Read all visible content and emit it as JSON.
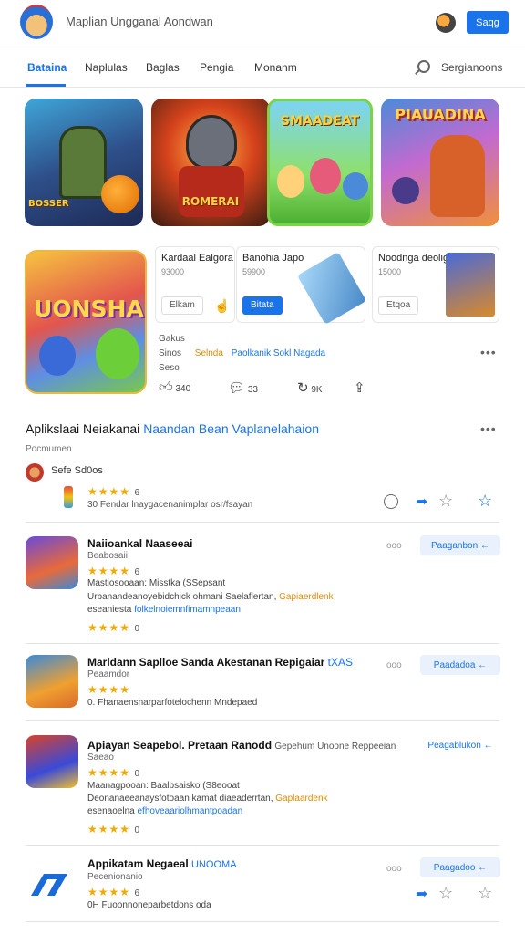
{
  "header": {
    "app_title": "Maplian Ungganal Aondwan",
    "login_label": "Saqg",
    "icons": [
      "avatar",
      "bell-icon"
    ]
  },
  "tabs": {
    "items": [
      "Bataina",
      "Naplulas",
      "Baglas",
      "Pengia",
      "Monanm"
    ],
    "active": "Bataina",
    "search_label": "Sergianoons"
  },
  "banners": [
    {
      "text": "BOSSER"
    },
    {
      "text": "ROMERAI"
    },
    {
      "text": "SMAADEAT"
    },
    {
      "text": "PIAUADINA"
    }
  ],
  "featured": {
    "icon_word": "UONSHAN",
    "cards": [
      {
        "title": "Kardaal Ealgora",
        "sub": "93000",
        "button": "Elkam"
      },
      {
        "title": "Banohia Japo",
        "sub": "59900",
        "button": "Bitata"
      },
      {
        "title": "Noodnga deolig",
        "sub": "15000",
        "button": "Etqoa"
      }
    ],
    "meta1": "Gakus",
    "meta2_label": "Sinos",
    "meta2_highlight": "Selnda",
    "meta2_links": "Paolkanik  Sokl  Nagada",
    "meta3": "Seso",
    "actions": {
      "likes": "340",
      "comments": "33",
      "shares": "9K"
    }
  },
  "section": {
    "title_dark": "Aplikslaai Neiakanai ",
    "title_blue": "Naandan Bean Vaplanelahaion",
    "subtitle": "Pocmumen",
    "author": "Sefe  Sd0os",
    "rating": "6",
    "review": "30 Fendar lnaygacenanimplar osr/fsayan"
  },
  "items": [
    {
      "title": "Naiioankal Naaseeai",
      "sub": "Beabosaii",
      "rating1": "6",
      "line1": "Mastiosooaan: Misstka (SSepsant",
      "line2_main": "Urbanandeanoyebidchick ohmani Saelaflertan, ",
      "line2_hl": "Gapiaerdlenk",
      "line3_main": "eseaniesta ",
      "line3_blue": "folkelnoiemnfimamnpeaan",
      "rating2": "0",
      "pill": "Paaganbon ←",
      "tag": "ooo"
    },
    {
      "title": "Marldann Saplloe Sanda Akestanan Repigaiar ",
      "title_blue": "tXAS",
      "sub": "Peaamdor",
      "line1": "0. Fhanaensnarparfotelochenn Mndepaed",
      "pill": "Paadadoa ←",
      "tag": "ooo"
    },
    {
      "title": "Apiayan Seapebol. Pretaan Ranodd ",
      "title_blue": "Gepehum Unoone Reppeeian",
      "sub": "Saeao",
      "rating1": "0",
      "line1": "Maanagpooan: Baalbsaisko (S8eooat",
      "line2_main": "Deonanaeeanaysfotoaan kamat diaeaderrtan, ",
      "line2_hl": "Gaplaardenk",
      "line3_main": "esenaoelna ",
      "line3_blue": "efhoveaariolhmantpoadan",
      "rating2": "0",
      "pill": "Peagablukon ←"
    },
    {
      "title": "Appikatam Negaeal ",
      "title_blue": "UNOOMA",
      "sub": "Pecenionanio",
      "rating1": "6",
      "line1": "0H Fuoonnoneparbetdons oda",
      "pill": "Paagadoo ←",
      "tag": "ooo"
    }
  ]
}
